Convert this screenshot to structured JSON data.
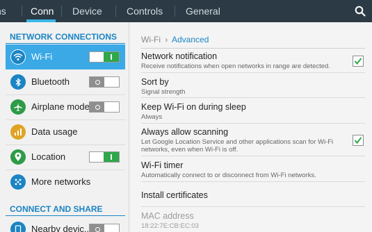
{
  "tabs": [
    {
      "label": "ns",
      "active": false
    },
    {
      "label": "Conn",
      "active": true
    },
    {
      "label": "Device",
      "active": false
    },
    {
      "label": "Controls",
      "active": false
    },
    {
      "label": "General",
      "active": false
    }
  ],
  "colors": {
    "accent": "#1b84c4",
    "selected": "#3aa9e6",
    "toggle_on": "#2ea84a",
    "topbar": "#2b3a45"
  },
  "sidebar": {
    "section1": "NETWORK CONNECTIONS",
    "section2": "CONNECT AND SHARE",
    "items": [
      {
        "label": "Wi-Fi",
        "icon": "wifi-icon",
        "toggle": "on",
        "selected": true
      },
      {
        "label": "Bluetooth",
        "icon": "bluetooth-icon",
        "toggle": "off"
      },
      {
        "label": "Airplane mode",
        "icon": "airplane-icon",
        "toggle": "off"
      },
      {
        "label": "Data usage",
        "icon": "data-usage-icon"
      },
      {
        "label": "Location",
        "icon": "location-icon",
        "toggle": "on"
      },
      {
        "label": "More networks",
        "icon": "more-networks-icon"
      },
      {
        "label": "Nearby devic...",
        "icon": "nearby-devices-icon",
        "toggle": "off"
      }
    ]
  },
  "breadcrumb": {
    "parent": "Wi-Fi",
    "separator": "›",
    "current": "Advanced"
  },
  "settings": [
    {
      "title": "Network notification",
      "subtitle": "Receive notifications when open networks in range are detected.",
      "checked": true
    },
    {
      "title": "Sort by",
      "subtitle": "Signal strength"
    },
    {
      "title": "Keep Wi-Fi on during sleep",
      "subtitle": "Always"
    },
    {
      "title": "Always allow scanning",
      "subtitle": "Let Google Location Service and other applications scan for Wi-Fi networks, even when Wi-Fi is off.",
      "checked": true
    },
    {
      "title": "Wi-Fi timer",
      "subtitle": "Automatically connect to or disconnect from Wi-Fi networks."
    },
    {
      "title": "Install certificates",
      "subtitle": ""
    },
    {
      "title": "MAC address",
      "subtitle": "18:22:7E:CB:EC:03",
      "disabled": true
    }
  ]
}
